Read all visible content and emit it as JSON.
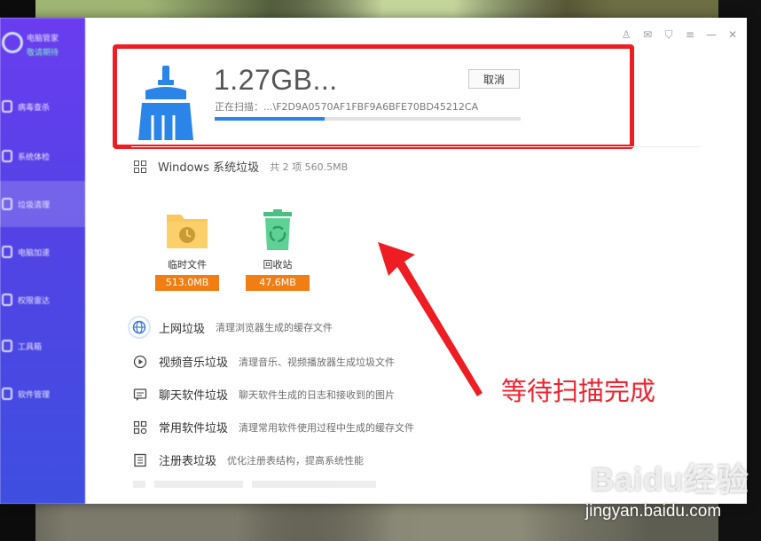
{
  "app": {
    "brand_line1": "电脑管家",
    "brand_line2": "敬请期待"
  },
  "sidebar": {
    "items": [
      {
        "label": "病毒查杀",
        "icon": "shield-icon"
      },
      {
        "label": "系统体检",
        "icon": "monitor-icon"
      },
      {
        "label": "垃圾清理",
        "icon": "broom-icon",
        "active": true
      },
      {
        "label": "电脑加速",
        "icon": "rocket-icon"
      },
      {
        "label": "权限雷达",
        "icon": "radar-icon"
      },
      {
        "label": "工具箱",
        "icon": "toolbox-icon"
      },
      {
        "label": "软件管理",
        "icon": "apps-icon"
      }
    ]
  },
  "titlebar": {
    "icons": [
      "shirt-icon",
      "mail-icon",
      "shield-icon",
      "menu-icon",
      "minimize-icon",
      "close-icon"
    ]
  },
  "scan": {
    "size": "1.27GB...",
    "status": "正在扫描：...\\F2D9A0570AF1FBF9A6BFE70BD45212CA",
    "cancel_label": "取消",
    "progress": 0.36,
    "progress_color": "#2b85e8"
  },
  "windows_junk": {
    "title": "Windows 系统垃圾",
    "summary": "共 2 项 560.5MB",
    "tiles": [
      {
        "name": "临时文件",
        "size": "513.0MB",
        "icon": "folder-clock-icon"
      },
      {
        "name": "回收站",
        "size": "47.6MB",
        "icon": "recycle-bin-icon"
      }
    ]
  },
  "categories": [
    {
      "title": "上网垃圾",
      "desc": "清理浏览器生成的缓存文件",
      "icon": "globe-icon"
    },
    {
      "title": "视频音乐垃圾",
      "desc": "清理音乐、视频播放器生成垃圾文件",
      "icon": "play-icon"
    },
    {
      "title": "聊天软件垃圾",
      "desc": "聊天软件生成的日志和接收到的图片",
      "icon": "chat-icon"
    },
    {
      "title": "常用软件垃圾",
      "desc": "清理常用软件使用过程中生成的缓存文件",
      "icon": "apps-grid-icon"
    },
    {
      "title": "注册表垃圾",
      "desc": "优化注册表结构，提高系统性能",
      "icon": "registry-icon"
    }
  ],
  "annotation": {
    "text": "等待扫描完成",
    "color": "#ee1d24"
  },
  "watermark": {
    "logo": "Baidu经验",
    "url": "jingyan.baidu.com"
  },
  "colors": {
    "accent": "#2b85e8",
    "size_badge": "#f07e14",
    "sidebar": "#5542e6"
  }
}
